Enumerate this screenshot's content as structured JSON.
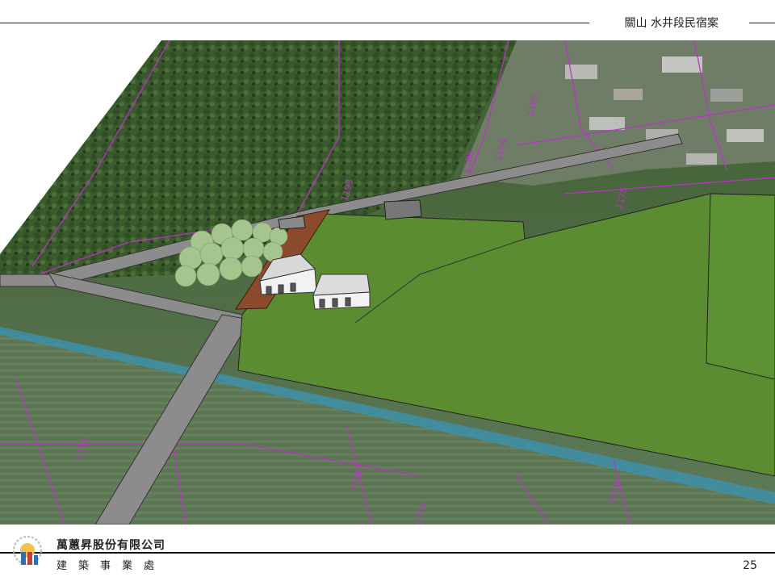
{
  "header": {
    "title": "關山 水井段民宿案"
  },
  "footer": {
    "company": "萬蕙昇股份有限公司",
    "division": "建築事業處",
    "page_number": "25"
  },
  "render": {
    "parcel_labels": [
      "1186",
      "1194",
      "1193",
      "1190",
      "1158",
      "1159",
      "1160",
      "1175",
      "1165",
      "1188",
      "1183",
      "1172",
      "1173",
      "1174",
      "1180",
      "1169",
      "1170"
    ],
    "colors": {
      "grass": "#5c8c32",
      "road": "#8c8c8c",
      "parcel_line": "#c02fd0",
      "deck": "#8b4a2b",
      "building": "#f2f2f2",
      "forest": "#3c5f2c",
      "canal": "#3e8fa8"
    }
  }
}
